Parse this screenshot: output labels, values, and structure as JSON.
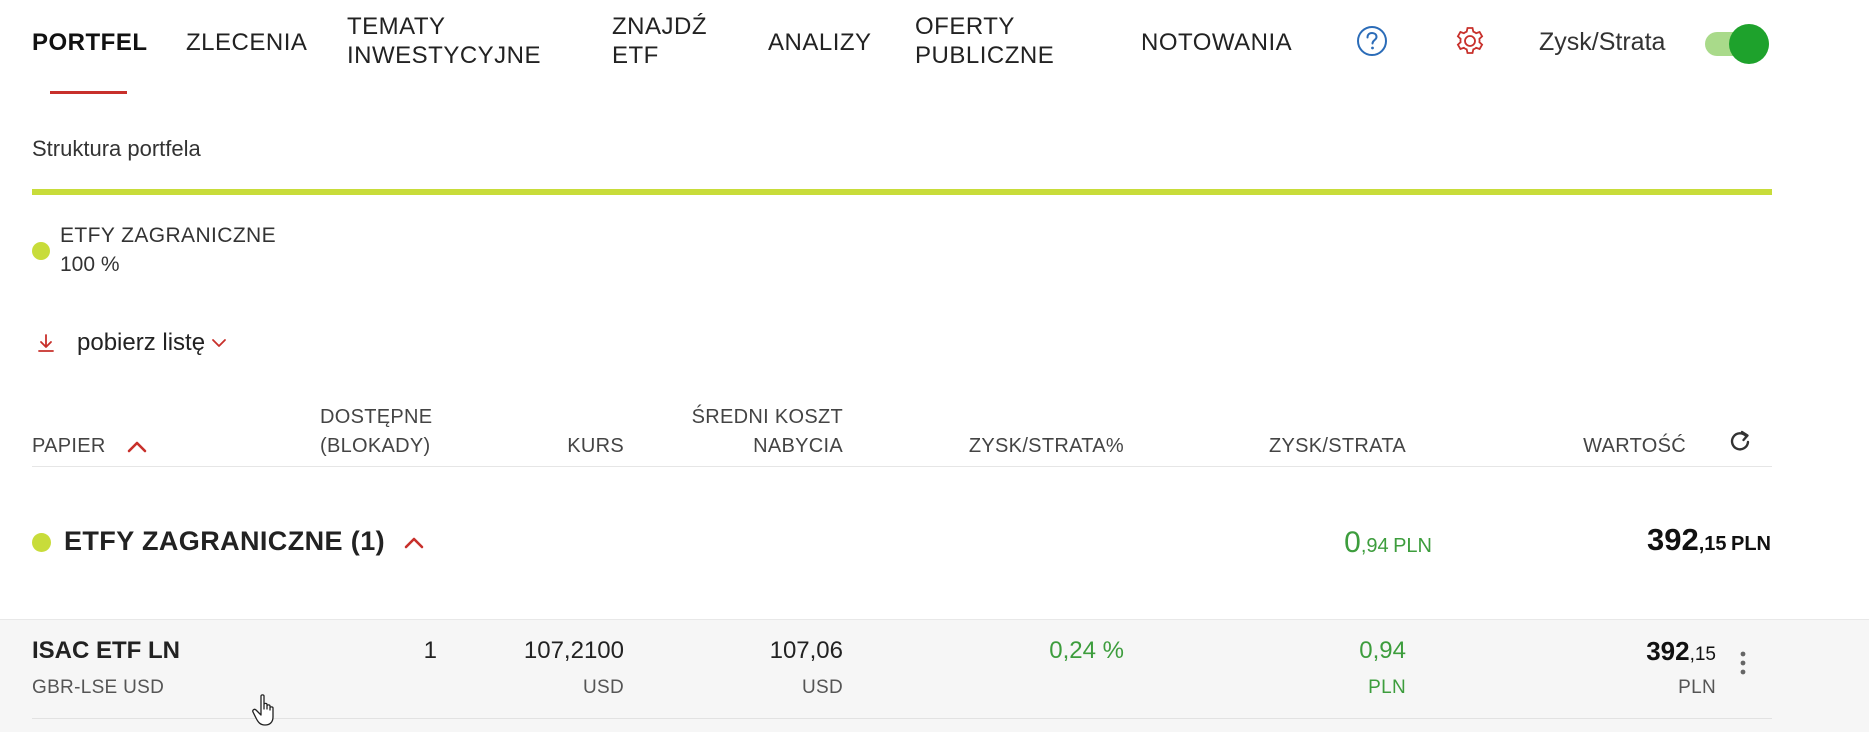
{
  "nav": {
    "items": [
      {
        "label": "PORTFEL",
        "active": true
      },
      {
        "label": "ZLECENIA"
      },
      {
        "label": "TEMATY INWESTYCYJNE"
      },
      {
        "label": "ZNAJDŹ ETF"
      },
      {
        "label": "ANALIZY"
      },
      {
        "label": "OFERTY PUBLICZNE"
      },
      {
        "label": "NOTOWANIA"
      }
    ],
    "help_icon": "question-circle-icon",
    "settings_icon": "gear-icon",
    "toggle_label": "Zysk/Strata",
    "toggle_on": true
  },
  "structure": {
    "title": "Struktura portfela",
    "bar_color": "#c8dc3a",
    "legend": [
      {
        "name": "ETFY ZAGRANICZNE",
        "percent_label": "100 %",
        "share": 1.0,
        "color": "#c8dc3a"
      }
    ]
  },
  "download": {
    "label": "pobierz listę",
    "icon": "download-icon"
  },
  "table": {
    "headers": {
      "paper": "PAPIER",
      "available_1": "DOSTĘPNE",
      "available_2": "(BLOKADY)",
      "price": "KURS",
      "avg_cost_1": "ŚREDNI KOSZT",
      "avg_cost_2": "NABYCIA",
      "pl_pct": "ZYSK/STRATA%",
      "pl": "ZYSK/STRATA",
      "value": "WARTOŚĆ"
    },
    "group": {
      "name": "ETFY ZAGRANICZNE (1)",
      "pl_int": "0",
      "pl_dec": ",94",
      "pl_cur": "PLN",
      "value_int": "392",
      "value_dec": ",15",
      "value_cur": "PLN"
    },
    "rows": [
      {
        "name": "ISAC ETF LN",
        "market": "GBR-LSE USD",
        "available": "1",
        "price": "107,2100",
        "price_cur": "USD",
        "avg_cost": "107,06",
        "avg_cost_cur": "USD",
        "pl_pct": "0,24 %",
        "pl": "0,94",
        "pl_cur": "PLN",
        "value_int": "392",
        "value_dec": ",15",
        "value_cur": "PLN"
      }
    ]
  },
  "colors": {
    "accent_red": "#c8302b",
    "etf_green_yellow": "#c8dc3a",
    "profit_green": "#3d9d3d",
    "toggle_green": "#1ea22c"
  }
}
